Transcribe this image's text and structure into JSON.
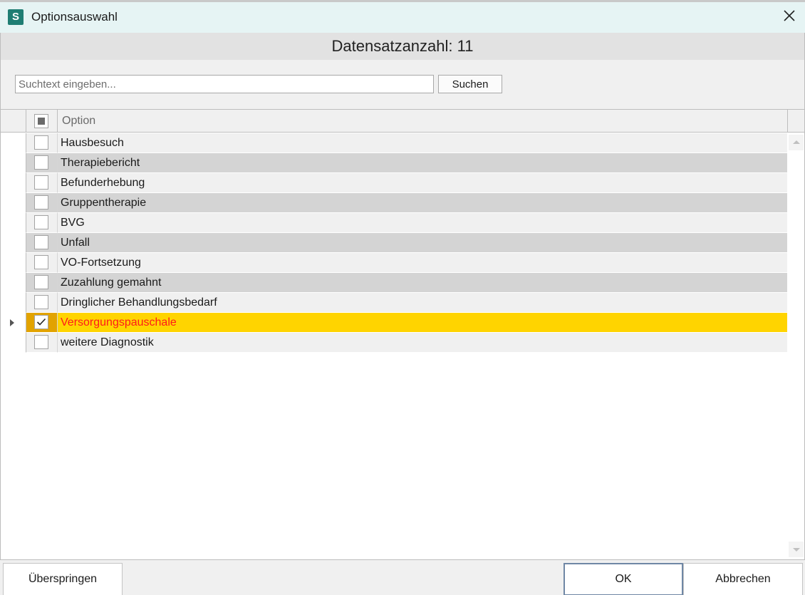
{
  "window": {
    "app_icon_letter": "S",
    "title": "Optionsauswahl",
    "close_icon": "close-icon"
  },
  "count_label": "Datensatzanzahl: 11",
  "search": {
    "placeholder": "Suchtext eingeben...",
    "value": "",
    "button_label": "Suchen"
  },
  "grid": {
    "header": {
      "select_all_state": "indeterminate",
      "column_label": "Option"
    },
    "rows": [
      {
        "label": "Hausbesuch",
        "checked": false,
        "selected": false
      },
      {
        "label": "Therapiebericht",
        "checked": false,
        "selected": false
      },
      {
        "label": "Befunderhebung",
        "checked": false,
        "selected": false
      },
      {
        "label": "Gruppentherapie",
        "checked": false,
        "selected": false
      },
      {
        "label": "BVG",
        "checked": false,
        "selected": false
      },
      {
        "label": "Unfall",
        "checked": false,
        "selected": false
      },
      {
        "label": "VO-Fortsetzung",
        "checked": false,
        "selected": false
      },
      {
        "label": "Zuzahlung gemahnt",
        "checked": false,
        "selected": false
      },
      {
        "label": "Dringlicher Behandlungsbedarf",
        "checked": false,
        "selected": false
      },
      {
        "label": "Versorgungspauschale",
        "checked": true,
        "selected": true
      },
      {
        "label": "weitere Diagnostik",
        "checked": false,
        "selected": false
      }
    ]
  },
  "footer": {
    "skip_label": "Überspringen",
    "ok_label": "OK",
    "cancel_label": "Abbrechen"
  },
  "colors": {
    "titlebar": "#e6f4f4",
    "app_icon": "#1f7d73",
    "selected_row": "#ffd400",
    "selected_text": "#ff1a1a"
  }
}
